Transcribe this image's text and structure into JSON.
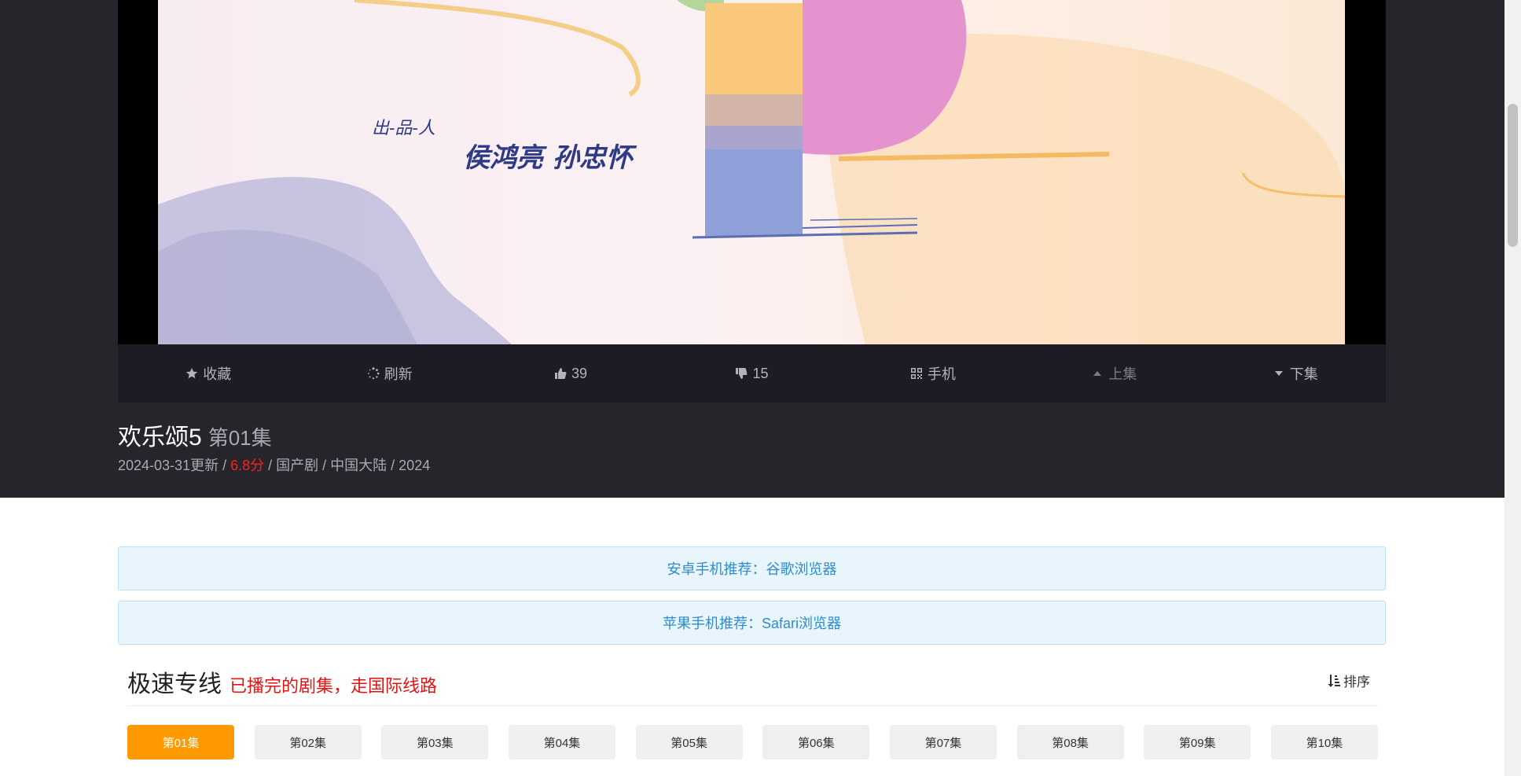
{
  "video": {
    "caption_role": "出-品-人",
    "caption_names": "侯鸿亮  孙忠怀"
  },
  "controls": [
    {
      "id": "favorite",
      "icon": "star-icon",
      "label": "收藏"
    },
    {
      "id": "refresh",
      "icon": "refresh-icon",
      "label": "刷新"
    },
    {
      "id": "like",
      "icon": "thumbs-up-icon",
      "label": "39"
    },
    {
      "id": "dislike",
      "icon": "thumbs-down-icon",
      "label": "15"
    },
    {
      "id": "mobile",
      "icon": "qrcode-icon",
      "label": "手机"
    },
    {
      "id": "prev",
      "icon": "caret-up-icon",
      "label": "上集"
    },
    {
      "id": "next",
      "icon": "caret-down-icon",
      "label": "下集"
    }
  ],
  "title": {
    "name": "欢乐颂5",
    "episode": "第01集"
  },
  "meta": {
    "updated": "2024-03-31更新",
    "score": "6.8分",
    "genre": "国产剧",
    "region": "中国大陆",
    "year": "2024",
    "separator": " / "
  },
  "tips": {
    "android": "安卓手机推荐：谷歌浏览器",
    "ios": "苹果手机推荐：Safari浏览器"
  },
  "playlist": {
    "title": "极速专线",
    "note": "已播完的剧集，走国际线路",
    "sort_label": "排序",
    "episodes": [
      "第01集",
      "第02集",
      "第03集",
      "第04集",
      "第05集",
      "第06集",
      "第07集",
      "第08集",
      "第09集",
      "第10集"
    ],
    "active_index": 0
  },
  "colors": {
    "accent": "#ff9900",
    "score": "#ff1f1f",
    "note": "#e11414",
    "tip_text": "#2c8ccc",
    "dark_bg": "#26252c"
  }
}
